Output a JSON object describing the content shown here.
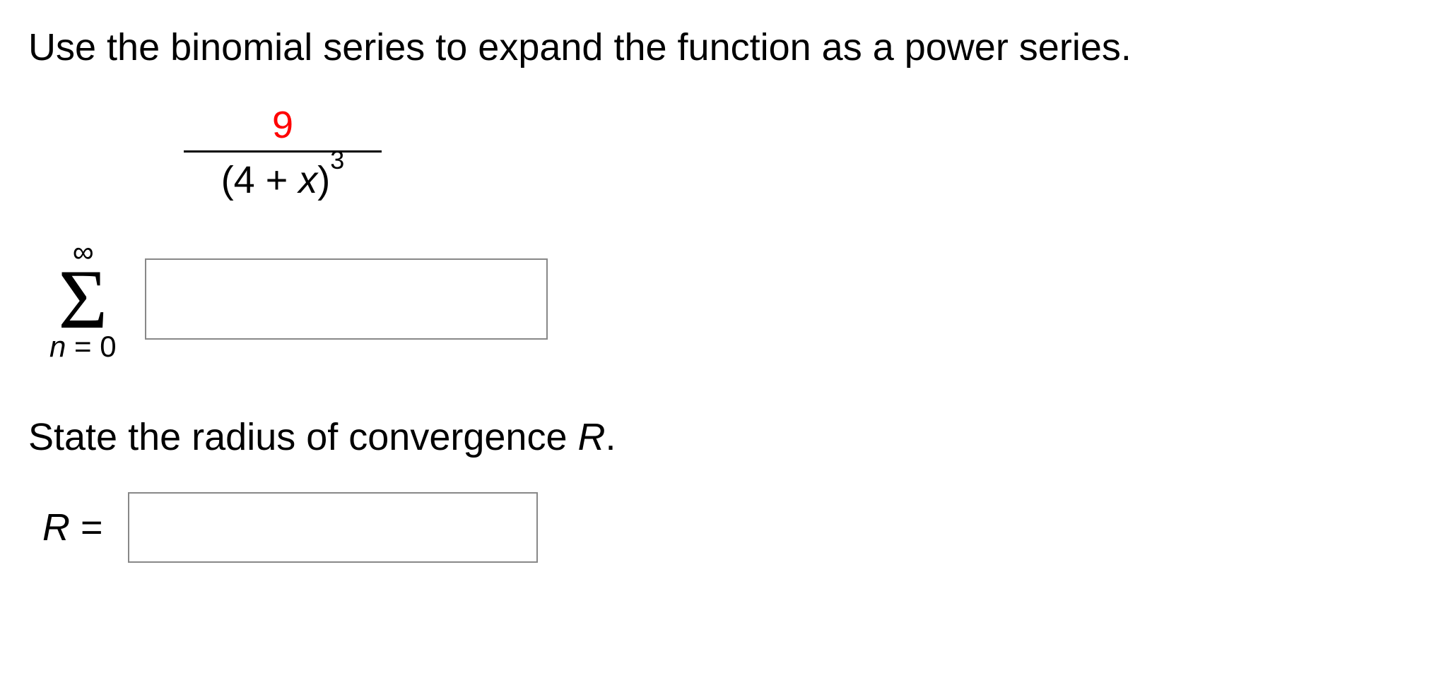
{
  "problem": {
    "instruction": "Use the binomial series to expand the function as a power series.",
    "expression": {
      "numerator": "9",
      "denominator_open": "(4 + ",
      "denominator_var": "x",
      "denominator_close": ")",
      "denominator_exp": "3"
    },
    "summation": {
      "upper_limit": "∞",
      "symbol": "Σ",
      "lower_var": "n",
      "lower_eq": " = 0"
    },
    "radius_prompt_prefix": "State the radius of convergence ",
    "radius_prompt_var": "R",
    "radius_prompt_suffix": ".",
    "radius_label_var": "R",
    "radius_label_eq": " ="
  }
}
